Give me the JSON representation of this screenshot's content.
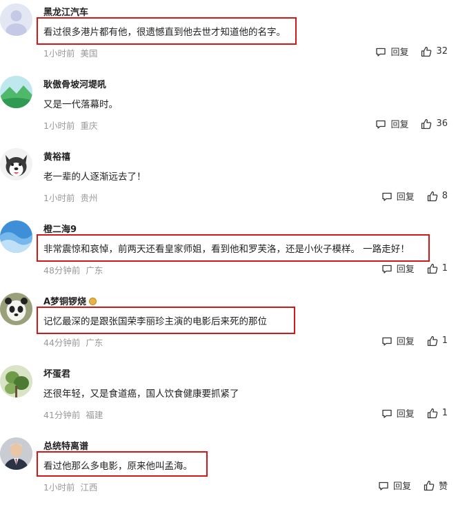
{
  "comments": [
    {
      "user": "黑龙江汽车",
      "text": "看过很多港片都有他，很遗憾直到他去世才知道他的名字。",
      "time": "1小时前",
      "location": "美国",
      "reply": "回复",
      "likes": "32",
      "avatar": "default-gray-avatar"
    },
    {
      "user": "耿傲骨坡河堤吼",
      "text": "又是一代落幕时。",
      "time": "1小时前",
      "location": "重庆",
      "reply": "回复",
      "likes": "36",
      "avatar": "mountain-landscape-avatar"
    },
    {
      "user": "黄裕禧",
      "text": "老一辈的人逐渐远去了！",
      "time": "1小时前",
      "location": "贵州",
      "reply": "回复",
      "likes": "8",
      "avatar": "husky-dog-avatar"
    },
    {
      "user": "橙二海9",
      "text": "非常震惊和哀悼，前两天还看皇家师姐，看到他和罗芙洛，还是小伙子模样。  一路走好！",
      "time": "48分钟前",
      "location": "广东",
      "reply": "回复",
      "likes": "1",
      "avatar": "ocean-wave-avatar"
    },
    {
      "user": "A梦铜锣烧",
      "text": "记忆最深的是跟张国荣李丽珍主演的电影后来死的那位",
      "time": "44分钟前",
      "location": "广东",
      "reply": "回复",
      "likes": "1",
      "avatar": "panda-avatar"
    },
    {
      "user": "坏蛋君",
      "text": "还很年轻，又是食道癌，国人饮食健康要抓紧了",
      "time": "41分钟前",
      "location": "福建",
      "reply": "回复",
      "likes": "1",
      "avatar": "green-plant-avatar"
    },
    {
      "user": "总统特离谱",
      "text": "看过他那么多电影，原来他叫孟海。",
      "time": "1小时前",
      "location": "江西",
      "reply": "回复",
      "likes": "赞",
      "avatar": "man-in-suit-avatar"
    }
  ],
  "colors": {
    "highlight": "#d61515",
    "meta": "#999999",
    "text": "#222222"
  }
}
